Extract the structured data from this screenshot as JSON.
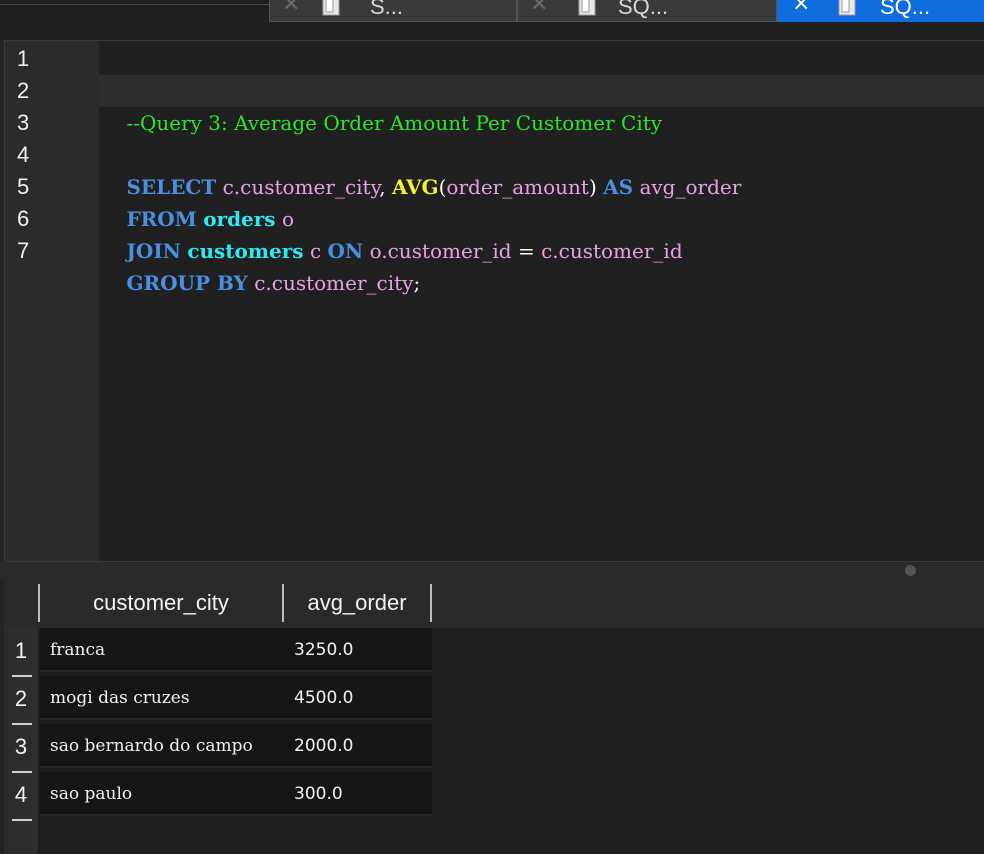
{
  "tabs": [
    {
      "label": "S...",
      "active": false
    },
    {
      "label": "SQ...",
      "active": false
    },
    {
      "label": "SQ...",
      "active": true
    }
  ],
  "editor": {
    "line_numbers": [
      "1",
      "2",
      "3",
      "4",
      "5",
      "6",
      "7"
    ],
    "lines": {
      "l2": {
        "comment": "--Query 3: Average Order Amount Per Customer City"
      },
      "l4": {
        "kw_select": "SELECT",
        "col1": "c.customer_city",
        "comma": ",",
        "fn_avg": "AVG",
        "paren_open": "(",
        "arg": "order_amount",
        "paren_close": ")",
        "kw_as": "AS",
        "alias": "avg_order"
      },
      "l5": {
        "kw_from": "FROM",
        "table": "orders",
        "alias": "o"
      },
      "l6": {
        "kw_join": "JOIN",
        "table": "customers",
        "alias": "c",
        "kw_on": "ON",
        "left": "o.customer_id",
        "eq": "=",
        "right": "c.customer_id"
      },
      "l7": {
        "kw_group": "GROUP BY",
        "col": "c.customer_city",
        "semi": ";"
      }
    }
  },
  "results": {
    "columns": [
      "customer_city",
      "avg_order"
    ],
    "row_numbers": [
      "1",
      "2",
      "3",
      "4"
    ],
    "rows": [
      [
        "franca",
        "3250.0"
      ],
      [
        "mogi das cruzes",
        "4500.0"
      ],
      [
        "sao bernardo do campo",
        "2000.0"
      ],
      [
        "sao paulo",
        "300.0"
      ]
    ]
  },
  "colors": {
    "comment": "#2ee52e",
    "keyword": "#4a90e2",
    "function": "#f5f233",
    "table": "#2fe8f0",
    "identifier": "#e7a1e4",
    "active_tab": "#0f6ddf"
  }
}
